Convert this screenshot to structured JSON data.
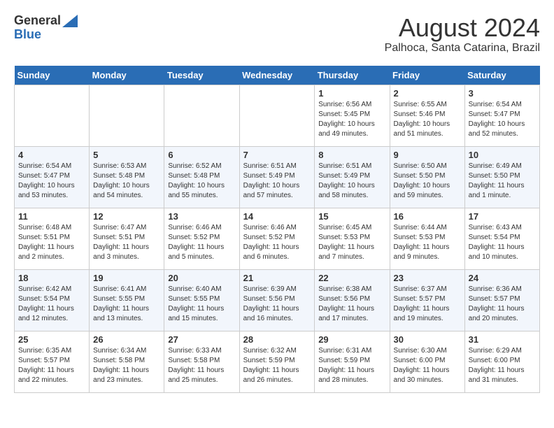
{
  "header": {
    "logo_general": "General",
    "logo_blue": "Blue",
    "month": "August 2024",
    "location": "Palhoca, Santa Catarina, Brazil"
  },
  "weekdays": [
    "Sunday",
    "Monday",
    "Tuesday",
    "Wednesday",
    "Thursday",
    "Friday",
    "Saturday"
  ],
  "weeks": [
    [
      {
        "day": "",
        "info": ""
      },
      {
        "day": "",
        "info": ""
      },
      {
        "day": "",
        "info": ""
      },
      {
        "day": "",
        "info": ""
      },
      {
        "day": "1",
        "info": "Sunrise: 6:56 AM\nSunset: 5:45 PM\nDaylight: 10 hours\nand 49 minutes."
      },
      {
        "day": "2",
        "info": "Sunrise: 6:55 AM\nSunset: 5:46 PM\nDaylight: 10 hours\nand 51 minutes."
      },
      {
        "day": "3",
        "info": "Sunrise: 6:54 AM\nSunset: 5:47 PM\nDaylight: 10 hours\nand 52 minutes."
      }
    ],
    [
      {
        "day": "4",
        "info": "Sunrise: 6:54 AM\nSunset: 5:47 PM\nDaylight: 10 hours\nand 53 minutes."
      },
      {
        "day": "5",
        "info": "Sunrise: 6:53 AM\nSunset: 5:48 PM\nDaylight: 10 hours\nand 54 minutes."
      },
      {
        "day": "6",
        "info": "Sunrise: 6:52 AM\nSunset: 5:48 PM\nDaylight: 10 hours\nand 55 minutes."
      },
      {
        "day": "7",
        "info": "Sunrise: 6:51 AM\nSunset: 5:49 PM\nDaylight: 10 hours\nand 57 minutes."
      },
      {
        "day": "8",
        "info": "Sunrise: 6:51 AM\nSunset: 5:49 PM\nDaylight: 10 hours\nand 58 minutes."
      },
      {
        "day": "9",
        "info": "Sunrise: 6:50 AM\nSunset: 5:50 PM\nDaylight: 10 hours\nand 59 minutes."
      },
      {
        "day": "10",
        "info": "Sunrise: 6:49 AM\nSunset: 5:50 PM\nDaylight: 11 hours\nand 1 minute."
      }
    ],
    [
      {
        "day": "11",
        "info": "Sunrise: 6:48 AM\nSunset: 5:51 PM\nDaylight: 11 hours\nand 2 minutes."
      },
      {
        "day": "12",
        "info": "Sunrise: 6:47 AM\nSunset: 5:51 PM\nDaylight: 11 hours\nand 3 minutes."
      },
      {
        "day": "13",
        "info": "Sunrise: 6:46 AM\nSunset: 5:52 PM\nDaylight: 11 hours\nand 5 minutes."
      },
      {
        "day": "14",
        "info": "Sunrise: 6:46 AM\nSunset: 5:52 PM\nDaylight: 11 hours\nand 6 minutes."
      },
      {
        "day": "15",
        "info": "Sunrise: 6:45 AM\nSunset: 5:53 PM\nDaylight: 11 hours\nand 7 minutes."
      },
      {
        "day": "16",
        "info": "Sunrise: 6:44 AM\nSunset: 5:53 PM\nDaylight: 11 hours\nand 9 minutes."
      },
      {
        "day": "17",
        "info": "Sunrise: 6:43 AM\nSunset: 5:54 PM\nDaylight: 11 hours\nand 10 minutes."
      }
    ],
    [
      {
        "day": "18",
        "info": "Sunrise: 6:42 AM\nSunset: 5:54 PM\nDaylight: 11 hours\nand 12 minutes."
      },
      {
        "day": "19",
        "info": "Sunrise: 6:41 AM\nSunset: 5:55 PM\nDaylight: 11 hours\nand 13 minutes."
      },
      {
        "day": "20",
        "info": "Sunrise: 6:40 AM\nSunset: 5:55 PM\nDaylight: 11 hours\nand 15 minutes."
      },
      {
        "day": "21",
        "info": "Sunrise: 6:39 AM\nSunset: 5:56 PM\nDaylight: 11 hours\nand 16 minutes."
      },
      {
        "day": "22",
        "info": "Sunrise: 6:38 AM\nSunset: 5:56 PM\nDaylight: 11 hours\nand 17 minutes."
      },
      {
        "day": "23",
        "info": "Sunrise: 6:37 AM\nSunset: 5:57 PM\nDaylight: 11 hours\nand 19 minutes."
      },
      {
        "day": "24",
        "info": "Sunrise: 6:36 AM\nSunset: 5:57 PM\nDaylight: 11 hours\nand 20 minutes."
      }
    ],
    [
      {
        "day": "25",
        "info": "Sunrise: 6:35 AM\nSunset: 5:57 PM\nDaylight: 11 hours\nand 22 minutes."
      },
      {
        "day": "26",
        "info": "Sunrise: 6:34 AM\nSunset: 5:58 PM\nDaylight: 11 hours\nand 23 minutes."
      },
      {
        "day": "27",
        "info": "Sunrise: 6:33 AM\nSunset: 5:58 PM\nDaylight: 11 hours\nand 25 minutes."
      },
      {
        "day": "28",
        "info": "Sunrise: 6:32 AM\nSunset: 5:59 PM\nDaylight: 11 hours\nand 26 minutes."
      },
      {
        "day": "29",
        "info": "Sunrise: 6:31 AM\nSunset: 5:59 PM\nDaylight: 11 hours\nand 28 minutes."
      },
      {
        "day": "30",
        "info": "Sunrise: 6:30 AM\nSunset: 6:00 PM\nDaylight: 11 hours\nand 30 minutes."
      },
      {
        "day": "31",
        "info": "Sunrise: 6:29 AM\nSunset: 6:00 PM\nDaylight: 11 hours\nand 31 minutes."
      }
    ]
  ]
}
